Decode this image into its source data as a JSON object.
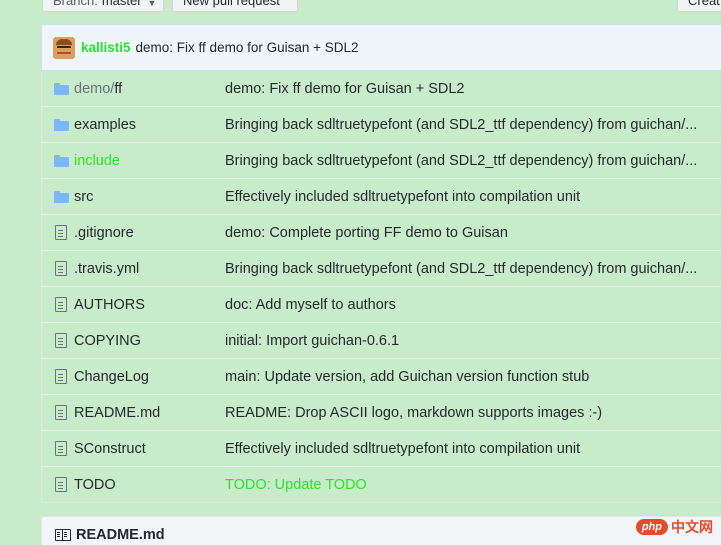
{
  "toolbar": {
    "branch_label": "Branch:",
    "branch_value": "master",
    "new_pull_request": "New pull request",
    "create_label": "Creat"
  },
  "commit": {
    "author": "kallisti5",
    "message": "demo: Fix ff demo for Guisan + SDL2"
  },
  "files": [
    {
      "type": "folder",
      "name_prefix": "demo/",
      "name": "ff",
      "message": "demo: Fix ff demo for Guisan + SDL2"
    },
    {
      "type": "folder",
      "name_prefix": "",
      "name": "examples",
      "message": "Bringing back sdltruetypefont (and SDL2_ttf dependency) from guichan/..."
    },
    {
      "type": "folder",
      "name_prefix": "",
      "name": "include",
      "message": "Bringing back sdltruetypefont (and SDL2_ttf dependency) from guichan/..."
    },
    {
      "type": "folder",
      "name_prefix": "",
      "name": "src",
      "message": "Effectively included sdltruetypefont into compilation unit"
    },
    {
      "type": "file",
      "name_prefix": "",
      "name": ".gitignore",
      "message": "demo: Complete porting FF demo to Guisan"
    },
    {
      "type": "file",
      "name_prefix": "",
      "name": ".travis.yml",
      "message": "Bringing back sdltruetypefont (and SDL2_ttf dependency) from guichan/..."
    },
    {
      "type": "file",
      "name_prefix": "",
      "name": "AUTHORS",
      "message": "doc: Add myself to authors"
    },
    {
      "type": "file",
      "name_prefix": "",
      "name": "COPYING",
      "message": "initial: Import guichan-0.6.1"
    },
    {
      "type": "file",
      "name_prefix": "",
      "name": "ChangeLog",
      "message": "main: Update version, add Guichan version function stub"
    },
    {
      "type": "file",
      "name_prefix": "",
      "name": "README.md",
      "message": "README: Drop ASCII logo, markdown supports images :-)"
    },
    {
      "type": "file",
      "name_prefix": "",
      "name": "SConstruct",
      "message": "Effectively included sdltruetypefont into compilation unit"
    },
    {
      "type": "file",
      "name_prefix": "",
      "name": "TODO",
      "message": "TODO: Update TODO"
    }
  ],
  "readme": {
    "title": "README.md"
  },
  "watermark": {
    "badge": "php",
    "text": "中文网"
  },
  "colors": {
    "background": "#c8ecca",
    "highlight_green": "#2ee02e",
    "folder_blue": "#79b8ff"
  }
}
